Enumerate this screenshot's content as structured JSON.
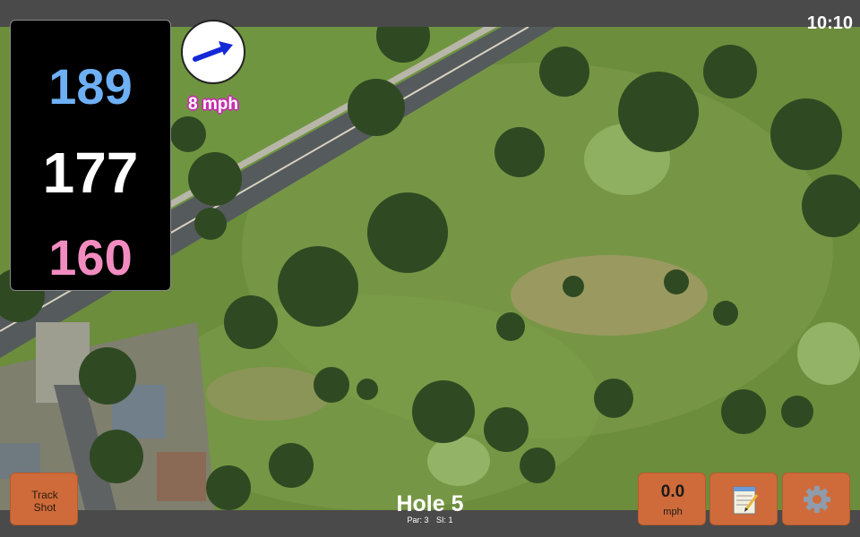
{
  "status_bar": {
    "time": "10:10"
  },
  "distances": {
    "back": "189",
    "middle": "177",
    "front": "160"
  },
  "wind": {
    "label": "8 mph",
    "icon": "wind-arrow-icon"
  },
  "hole": {
    "title": "Hole 5",
    "par": "Par: 3",
    "stroke_index": "SI: 1"
  },
  "buttons": {
    "track_shot": {
      "line1": "Track",
      "line2": "Shot"
    },
    "speed": {
      "value": "0.0",
      "unit": "mph"
    },
    "notes": {
      "icon": "notepad-icon"
    },
    "settings": {
      "icon": "gear-icon"
    }
  },
  "colors": {
    "back_distance": "#6eb0f5",
    "middle_distance": "#ffffff",
    "front_distance": "#f28cc0",
    "button_orange": "#cf6b3a",
    "wind_label_outline": "#c62fae"
  }
}
